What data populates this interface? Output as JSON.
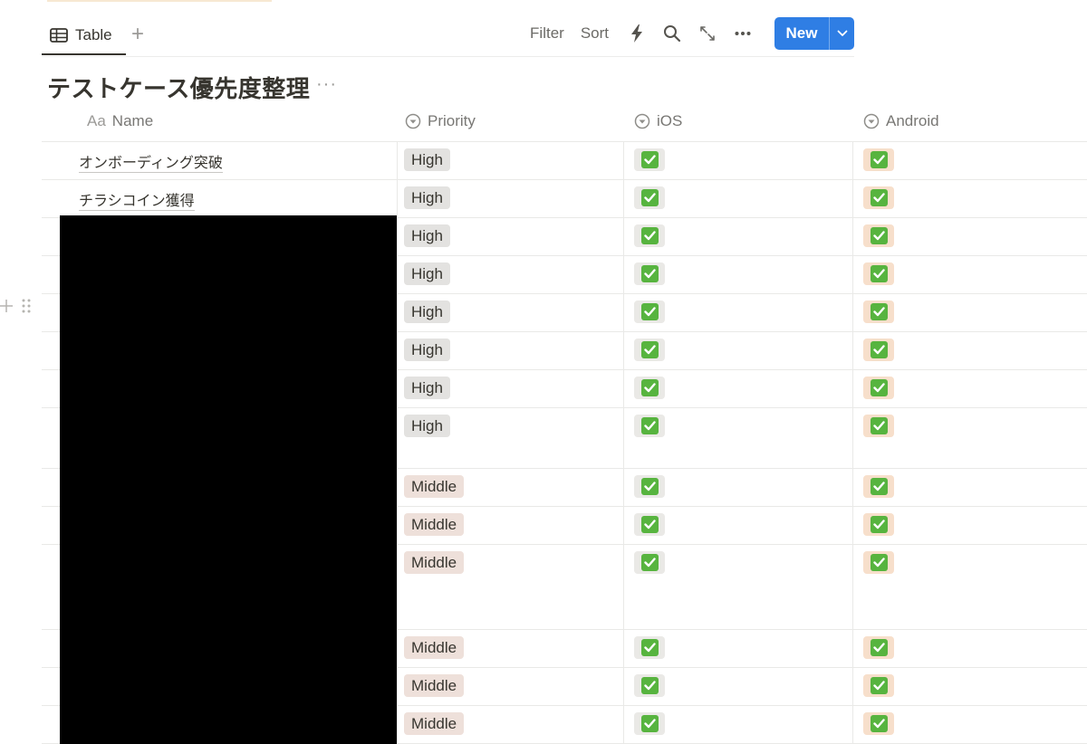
{
  "view": {
    "tab_label": "Table",
    "add_view": "+",
    "icon_table": "table-icon"
  },
  "toolbar": {
    "filter": "Filter",
    "sort": "Sort",
    "automation_icon": "lightning-icon",
    "search_icon": "search-icon",
    "expand_icon": "expand-icon",
    "more_icon": "more-icon",
    "new_label": "New",
    "accent": "#2f7ee4"
  },
  "database": {
    "title": "テストケース優先度整理",
    "more": "···"
  },
  "columns": {
    "name": "Name",
    "name_prefix": "Aa",
    "priority": "Priority",
    "ios": "iOS",
    "android": "Android"
  },
  "rows": [
    {
      "name": "オンボーディング突破",
      "priority": "High",
      "ios": true,
      "android": true
    },
    {
      "name": "チラシコイン獲得",
      "priority": "High",
      "ios": true,
      "android": true
    },
    {
      "name": "",
      "priority": "High",
      "ios": true,
      "android": true
    },
    {
      "name": "",
      "priority": "High",
      "ios": true,
      "android": true
    },
    {
      "name": "",
      "priority": "High",
      "ios": true,
      "android": true
    },
    {
      "name": "",
      "priority": "High",
      "ios": true,
      "android": true
    },
    {
      "name": "",
      "priority": "High",
      "ios": true,
      "android": true
    },
    {
      "name": "",
      "priority": "High",
      "ios": true,
      "android": true
    },
    {
      "name": "",
      "priority": "Middle",
      "ios": true,
      "android": true
    },
    {
      "name": "",
      "priority": "Middle",
      "ios": true,
      "android": true
    },
    {
      "name": "",
      "priority": "Middle",
      "ios": true,
      "android": true
    },
    {
      "name": "",
      "priority": "Middle",
      "ios": true,
      "android": true
    },
    {
      "name": "",
      "priority": "Middle",
      "ios": true,
      "android": true
    },
    {
      "name": "",
      "priority": "Middle",
      "ios": true,
      "android": true
    }
  ],
  "tag_colors": {
    "High": "#e3e2e0",
    "Middle": "#eee0da"
  }
}
